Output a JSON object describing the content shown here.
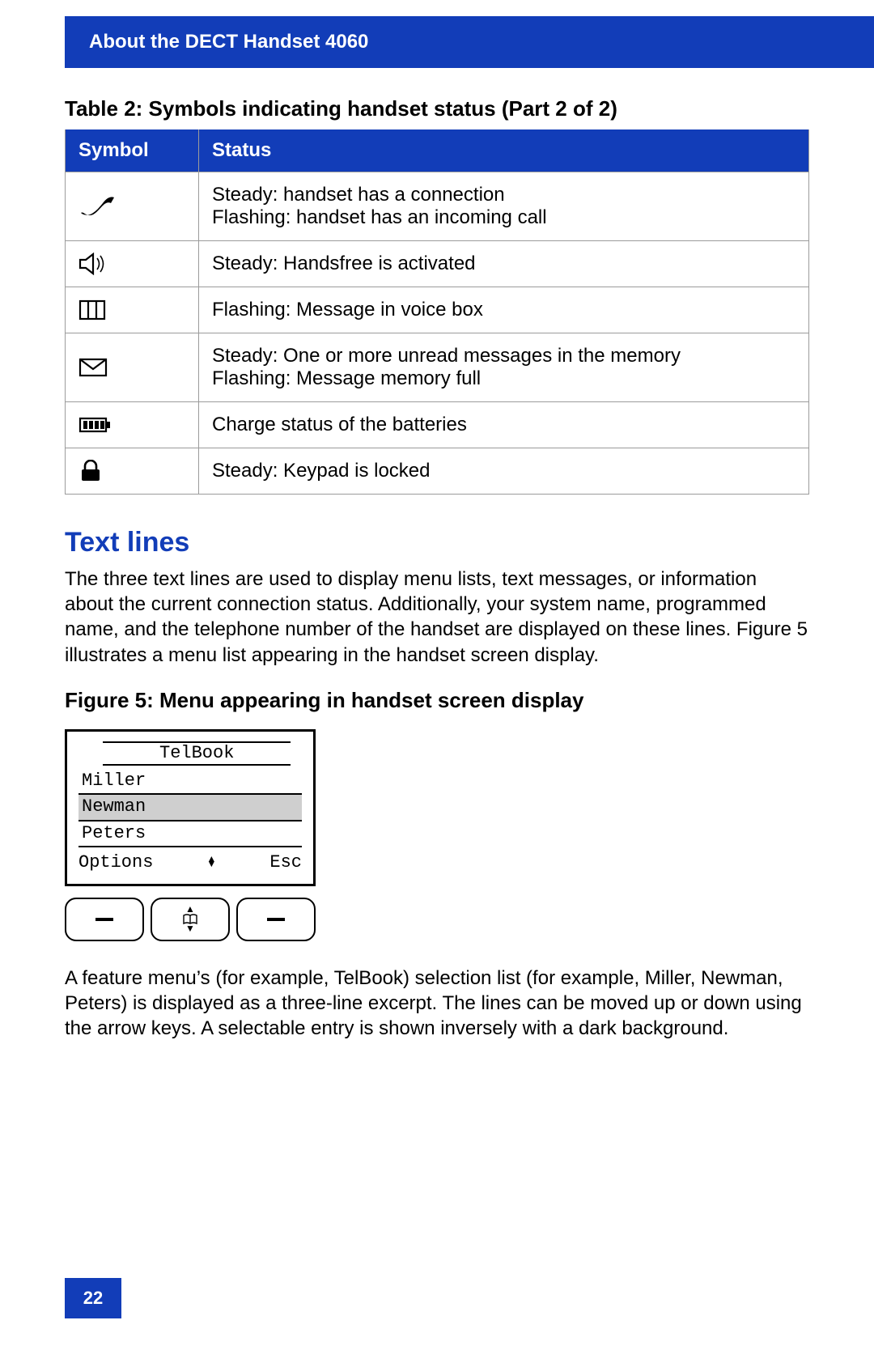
{
  "header": {
    "title": "About the DECT Handset 4060"
  },
  "table": {
    "caption": "Table 2: Symbols indicating handset status (Part 2 of 2)",
    "col_symbol": "Symbol",
    "col_status": "Status",
    "rows": [
      {
        "icon": "phone-icon",
        "status": "Steady: handset has a connection\nFlashing: handset has an incoming call"
      },
      {
        "icon": "speaker-icon",
        "status": "Steady: Handsfree is activated"
      },
      {
        "icon": "voicebox-icon",
        "status": "Flashing: Message in voice box"
      },
      {
        "icon": "envelope-icon",
        "status": "Steady: One or more unread messages in the memory\nFlashing: Message memory full"
      },
      {
        "icon": "battery-icon",
        "status": "Charge status of the batteries"
      },
      {
        "icon": "lock-icon",
        "status": "Steady: Keypad is locked"
      }
    ]
  },
  "section": {
    "heading": "Text lines",
    "para1": "The three text lines are used to display menu lists, text messages, or information about the current connection status. Additionally, your system name, programmed name, and the telephone number of the handset are displayed on these lines. Figure 5 illustrates a menu list appearing in the handset screen display."
  },
  "figure": {
    "caption": "Figure 5: Menu appearing in handset screen display",
    "lcd": {
      "title": "TelBook",
      "entries": [
        "Miller",
        "Newman",
        "Peters"
      ],
      "selected_index": 1,
      "left_soft": "Options",
      "right_soft": "Esc"
    }
  },
  "para2": "A feature menu’s (for example, TelBook) selection list (for example, Miller, Newman, Peters) is displayed as a three-line excerpt. The lines can be moved up or down using the arrow keys. A selectable entry is shown inversely with a dark background.",
  "page_number": "22"
}
